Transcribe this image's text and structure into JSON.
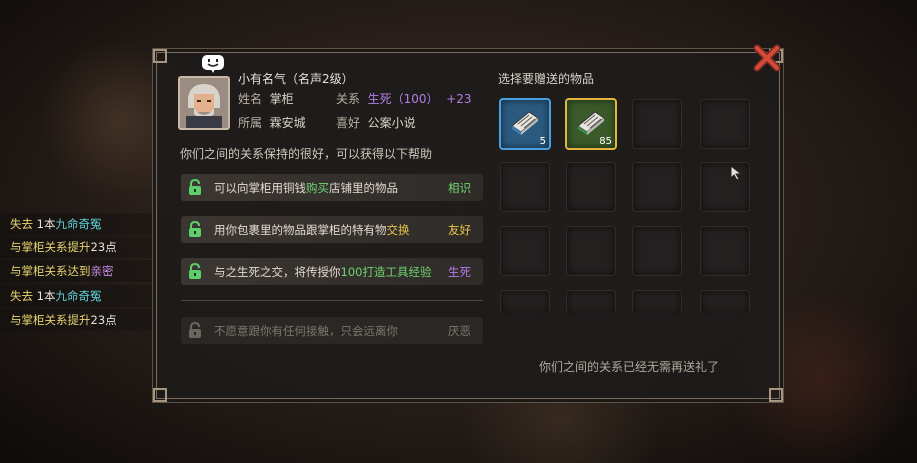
{
  "npc": {
    "fame_title": "小有名气（名声2级）",
    "name_label": "姓名",
    "name": "掌柜",
    "relation_label": "关系",
    "relation": "生死（100）",
    "relation_delta": "+23",
    "home_label": "所属",
    "home": "霖安城",
    "hobby_label": "喜好",
    "hobby": "公案小说",
    "description": "你们之间的关系保持的很好，可以获得以下帮助"
  },
  "help_items": [
    {
      "pre": "可以向掌柜用铜钱",
      "hl": "购买",
      "post": "店铺里的物品",
      "tier": "相识",
      "tier_color": "#6fd66f",
      "hl_color": "#6fd66f"
    },
    {
      "pre": "用你包裹里的物品跟掌柜的特有物",
      "hl": "交换",
      "post": "",
      "tier": "友好",
      "tier_color": "#e8c84a",
      "hl_color": "#e8c84a"
    },
    {
      "pre": "与之生死之交，将传授你",
      "hl": "100打造工具经验",
      "post": "",
      "tier": "生死",
      "tier_color": "#b47ce6",
      "hl_color": "#6fd66f"
    },
    {
      "pre": "不愿意跟你有任何接触，只会远离你",
      "hl": "",
      "post": "",
      "tier": "厌恶",
      "tier_color": "#7c766e",
      "hl_color": "#7c766e"
    }
  ],
  "gift": {
    "title": "选择要赠送的物品",
    "slots": [
      {
        "item": "book-blue",
        "count": "5"
      },
      {
        "item": "book-green",
        "count": "85"
      }
    ],
    "footer": "你们之间的关系已经无需再送礼了"
  },
  "log": [
    {
      "parts": [
        {
          "t": "失去 ",
          "c": "y"
        },
        {
          "t": "1本",
          "c": "w"
        },
        {
          "t": "九命奇冤",
          "c": "c"
        }
      ]
    },
    {
      "parts": [
        {
          "t": "与掌柜关系提升",
          "c": "y"
        },
        {
          "t": "23点",
          "c": "w"
        }
      ]
    },
    {
      "parts": [
        {
          "t": "与掌柜关系达到",
          "c": "y"
        },
        {
          "t": "亲密",
          "c": "p"
        }
      ]
    },
    {
      "parts": [
        {
          "t": "失去 ",
          "c": "y"
        },
        {
          "t": "1本",
          "c": "w"
        },
        {
          "t": "九命奇冤",
          "c": "c"
        }
      ]
    },
    {
      "parts": [
        {
          "t": "与掌柜关系提升",
          "c": "y"
        },
        {
          "t": "23点",
          "c": "w"
        }
      ]
    }
  ],
  "icons": {
    "close": "close-x-icon",
    "lock": "lock-icon",
    "book": "book-icon",
    "emote": "smile-emote-icon",
    "cursor": "mouse-cursor-icon"
  },
  "colors": {
    "purple": "#b47ce6",
    "green": "#6fd66f",
    "yellow": "#e8c84a",
    "close_red": "#d64a3a"
  }
}
